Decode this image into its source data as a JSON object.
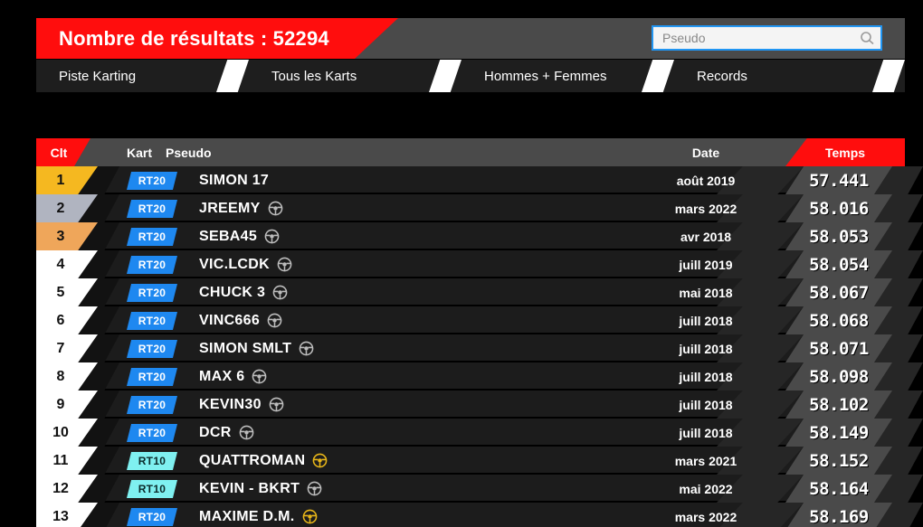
{
  "header": {
    "result_count_label": "Nombre de résultats : 52294",
    "search": {
      "placeholder": "Pseudo",
      "value": "",
      "icon": "search-icon"
    }
  },
  "nav": {
    "tabs": [
      {
        "label": "Piste Karting"
      },
      {
        "label": "Tous les Karts"
      },
      {
        "label": "Hommes + Femmes"
      },
      {
        "label": "Records"
      }
    ]
  },
  "table": {
    "columns": {
      "rank": "Clt",
      "kart": "Kart",
      "pseudo": "Pseudo",
      "date": "Date",
      "time": "Temps"
    },
    "rows": [
      {
        "rank": "1",
        "kart": "RT20",
        "pseudo": "SIMON 17",
        "wheel": "none",
        "date": "août 2019",
        "time": "57.441"
      },
      {
        "rank": "2",
        "kart": "RT20",
        "pseudo": "JREEMY",
        "wheel": "gray",
        "date": "mars 2022",
        "time": "58.016"
      },
      {
        "rank": "3",
        "kart": "RT20",
        "pseudo": "SEBA45",
        "wheel": "gray",
        "date": "avr 2018",
        "time": "58.053"
      },
      {
        "rank": "4",
        "kart": "RT20",
        "pseudo": "VIC.LCDK",
        "wheel": "gray",
        "date": "juill 2019",
        "time": "58.054"
      },
      {
        "rank": "5",
        "kart": "RT20",
        "pseudo": "CHUCK 3",
        "wheel": "gray",
        "date": "mai 2018",
        "time": "58.067"
      },
      {
        "rank": "6",
        "kart": "RT20",
        "pseudo": "VINC666",
        "wheel": "gray",
        "date": "juill 2018",
        "time": "58.068"
      },
      {
        "rank": "7",
        "kart": "RT20",
        "pseudo": "SIMON SMLT",
        "wheel": "gray",
        "date": "juill 2018",
        "time": "58.071"
      },
      {
        "rank": "8",
        "kart": "RT20",
        "pseudo": "MAX 6",
        "wheel": "gray",
        "date": "juill 2018",
        "time": "58.098"
      },
      {
        "rank": "9",
        "kart": "RT20",
        "pseudo": "KEVIN30",
        "wheel": "gray",
        "date": "juill 2018",
        "time": "58.102"
      },
      {
        "rank": "10",
        "kart": "RT20",
        "pseudo": "DCR",
        "wheel": "gray",
        "date": "juill 2018",
        "time": "58.149"
      },
      {
        "rank": "11",
        "kart": "RT10",
        "pseudo": "QUATTROMAN",
        "wheel": "gold",
        "date": "mars 2021",
        "time": "58.152"
      },
      {
        "rank": "12",
        "kart": "RT10",
        "pseudo": "KEVIN - BKRT",
        "wheel": "gray",
        "date": "mai 2022",
        "time": "58.164"
      },
      {
        "rank": "13",
        "kart": "RT20",
        "pseudo": "MAXIME D.M.",
        "wheel": "gold",
        "date": "mars 2022",
        "time": "58.169"
      }
    ]
  },
  "colors": {
    "accent_red": "#ff0d0d",
    "rank_gold": "#f5b820",
    "rank_silver": "#b0b4c0",
    "rank_bronze": "#efa65a",
    "rank_default": "#ffffff",
    "kart_rt20": "#1e88f0",
    "kart_rt10": "#7ff0f0",
    "wheel_gold": "#e8b619",
    "wheel_gray": "#bdbdbd",
    "search_border": "#2196f3",
    "row_bg": "#1c1c1c",
    "header_bg": "#4a4a4a"
  }
}
